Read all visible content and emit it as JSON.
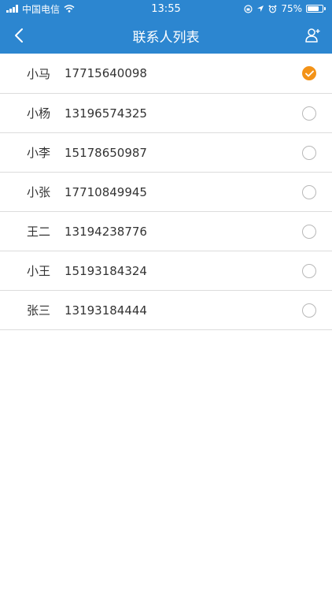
{
  "status_bar": {
    "carrier": "中国电信",
    "time": "13:55",
    "battery": "75%",
    "battery_level": 0.75
  },
  "nav": {
    "title": "联系人列表",
    "back_icon": "chevron-left-icon",
    "right_icon": "add-contact-icon"
  },
  "colors": {
    "primary": "#2c86d0",
    "accent": "#f39318"
  },
  "contacts": [
    {
      "name": "小马",
      "phone": "17715640098",
      "selected": true
    },
    {
      "name": "小杨",
      "phone": "13196574325",
      "selected": false
    },
    {
      "name": "小李",
      "phone": "15178650987",
      "selected": false
    },
    {
      "name": "小张",
      "phone": "17710849945",
      "selected": false
    },
    {
      "name": "王二",
      "phone": "13194238776",
      "selected": false
    },
    {
      "name": "小王",
      "phone": "15193184324",
      "selected": false
    },
    {
      "name": "张三",
      "phone": "13193184444",
      "selected": false
    }
  ]
}
